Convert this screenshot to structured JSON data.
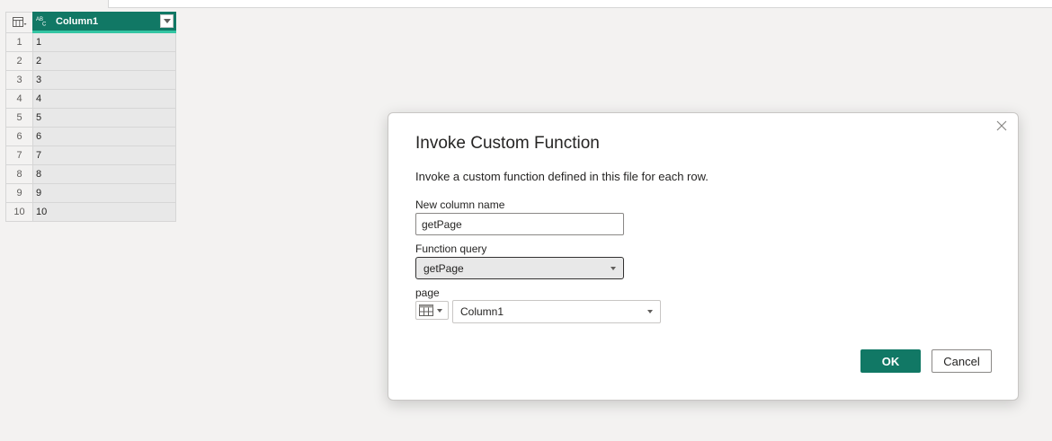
{
  "grid": {
    "column_header": "Column1",
    "column_type_icon": "ABC/123",
    "rows": [
      {
        "index": "1",
        "value": "1"
      },
      {
        "index": "2",
        "value": "2"
      },
      {
        "index": "3",
        "value": "3"
      },
      {
        "index": "4",
        "value": "4"
      },
      {
        "index": "5",
        "value": "5"
      },
      {
        "index": "6",
        "value": "6"
      },
      {
        "index": "7",
        "value": "7"
      },
      {
        "index": "8",
        "value": "8"
      },
      {
        "index": "9",
        "value": "9"
      },
      {
        "index": "10",
        "value": "10"
      }
    ]
  },
  "dialog": {
    "title": "Invoke Custom Function",
    "description": "Invoke a custom function defined in this file for each row.",
    "new_column_label": "New column name",
    "new_column_value": "getPage",
    "function_query_label": "Function query",
    "function_query_value": "getPage",
    "param_label": "page",
    "param_value": "Column1",
    "ok_label": "OK",
    "cancel_label": "Cancel"
  },
  "colors": {
    "accent": "#117865",
    "accent_highlight": "#33c5a3",
    "background": "#f3f2f1"
  }
}
